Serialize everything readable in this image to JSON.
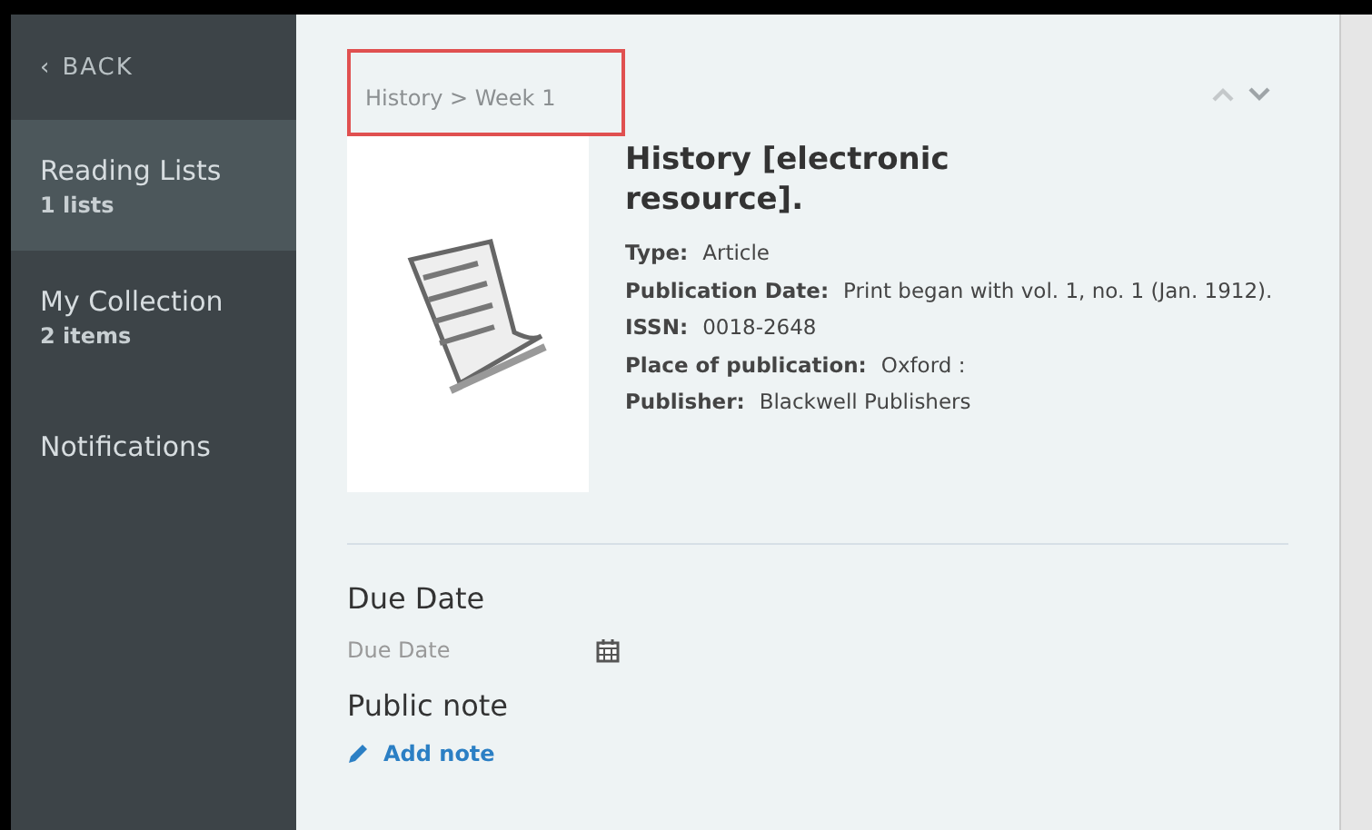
{
  "sidebar": {
    "back": {
      "icon": "‹",
      "label": "BACK"
    },
    "items": [
      {
        "label": "Reading Lists",
        "count": "1 lists",
        "selected": true
      },
      {
        "label": "My Collection",
        "count": "2 items",
        "selected": false
      },
      {
        "label": "Notifications",
        "selected": false
      }
    ]
  },
  "breadcrumb": {
    "text": "History > Week 1",
    "highlighted": true
  },
  "record": {
    "title": "History [electronic resource].",
    "fields": [
      {
        "label": "Type:",
        "value": "Article"
      },
      {
        "label": "Publication Date:",
        "value": "Print began with vol. 1, no. 1 (Jan. 1912)."
      },
      {
        "label": "ISSN:",
        "value": "0018-2648"
      },
      {
        "label": "Place of publication:",
        "value": "Oxford :"
      },
      {
        "label": "Publisher:",
        "value": "Blackwell Publishers"
      }
    ]
  },
  "due_date": {
    "heading": "Due Date",
    "placeholder": "Due Date"
  },
  "public_note": {
    "heading": "Public note",
    "action": "Add note"
  }
}
